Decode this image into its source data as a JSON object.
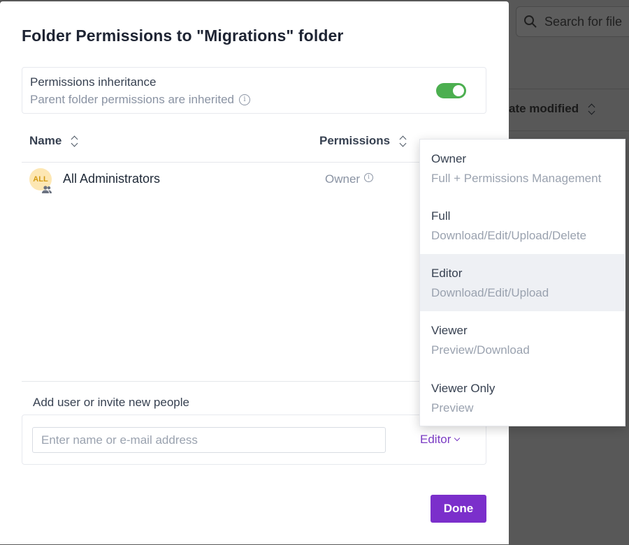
{
  "background": {
    "search_placeholder": "Search for file",
    "column_label": "ate modified"
  },
  "modal": {
    "title": "Folder Permissions to \"Migrations\" folder",
    "inheritance": {
      "title": "Permissions inheritance",
      "subtitle": "Parent folder permissions are inherited",
      "enabled": true
    },
    "columns": {
      "name": "Name",
      "permissions": "Permissions"
    },
    "rows": [
      {
        "avatar_text": "ALL",
        "name": "All Administrators",
        "permission": "Owner"
      }
    ],
    "add": {
      "label": "Add user or invite new people",
      "input_placeholder": "Enter name or e-mail address",
      "input_value": "",
      "selected_permission": "Editor"
    },
    "done_label": "Done"
  },
  "menu": {
    "items": [
      {
        "title": "Owner",
        "description": "Full + Permissions Management"
      },
      {
        "title": "Full",
        "description": "Download/Edit/Upload/Delete"
      },
      {
        "title": "Editor",
        "description": "Download/Edit/Upload",
        "active": true
      },
      {
        "title": "Viewer",
        "description": "Preview/Download"
      },
      {
        "title": "Viewer Only",
        "description": "Preview"
      }
    ]
  },
  "colors": {
    "accent": "#7b2fcb",
    "toggle_on": "#4caf50",
    "avatar_bg": "#fde7b3",
    "avatar_text": "#d39a11"
  }
}
